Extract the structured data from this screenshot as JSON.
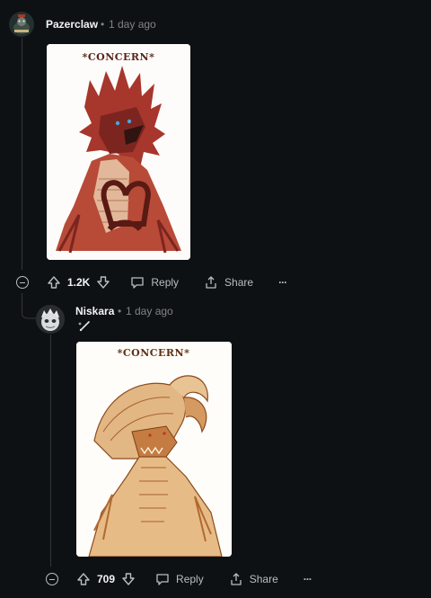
{
  "comments": [
    {
      "username": "Pazerclaw",
      "separator": "•",
      "timestamp": "1 day ago",
      "image_caption": "*CONCERN*",
      "votes": "1.2K",
      "reply_label": "Reply",
      "share_label": "Share",
      "more_label": "···"
    },
    {
      "username": "Niskara",
      "separator": "•",
      "timestamp": "1 day ago",
      "image_caption": "*CONCERN*",
      "votes": "709",
      "reply_label": "Reply",
      "share_label": "Share",
      "more_label": "···"
    }
  ],
  "icons": {
    "collapse": "minus-circle-icon",
    "upvote": "arrow-up-icon",
    "downvote": "arrow-down-icon",
    "reply": "speech-bubble-icon",
    "share": "share-icon",
    "more": "ellipsis-icon"
  },
  "colors": {
    "background": "#0e1113",
    "text_muted": "#818384",
    "text_primary": "#f2f4f5",
    "thread_line": "#343536"
  }
}
